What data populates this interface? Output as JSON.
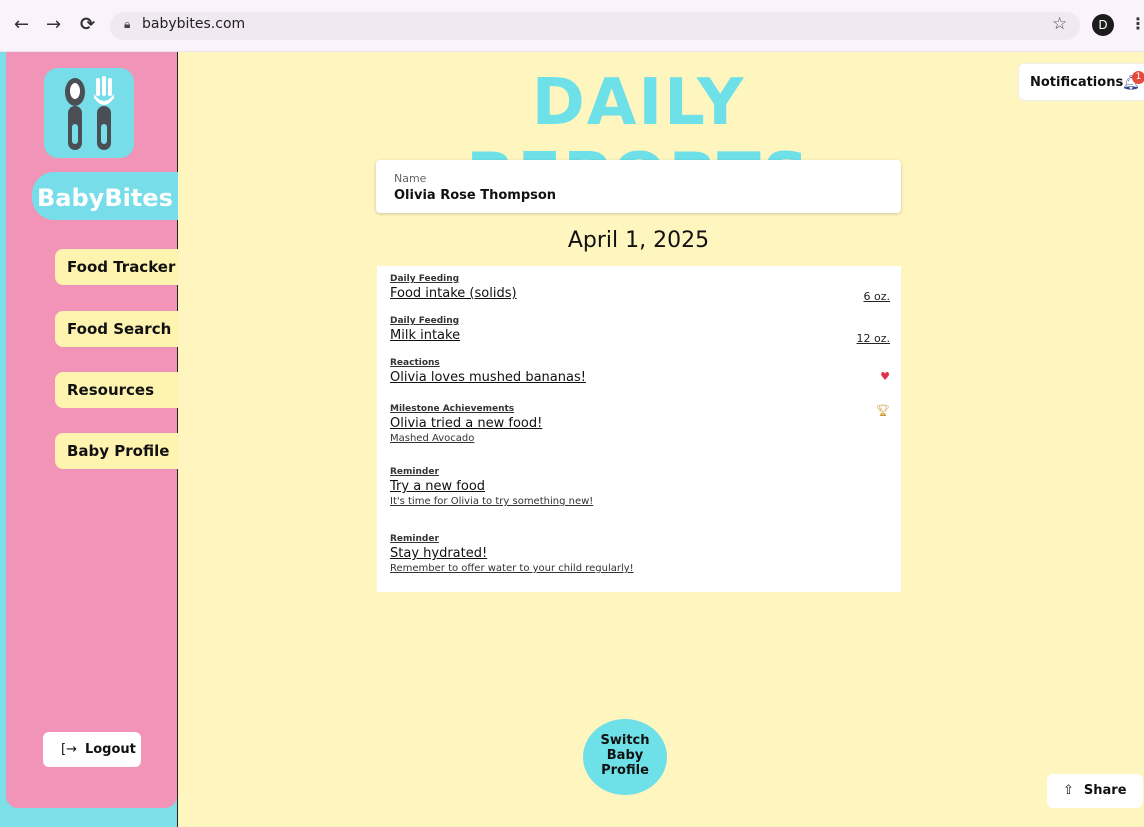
{
  "browser": {
    "url": "babybites.com",
    "back_icon": "←",
    "forward_icon": "→",
    "reload_icon": "C",
    "avatar_letter": "D"
  },
  "sidebar": {
    "brand": "BabyBites",
    "items": [
      {
        "label": "Food Tracker"
      },
      {
        "label": "Food Search"
      },
      {
        "label": "Resources"
      },
      {
        "label": "Baby Profile"
      }
    ],
    "logout_label": "Logout"
  },
  "header": {
    "title": "DAILY REPORTS",
    "notifications_label": "Notifications",
    "notifications_count": "1"
  },
  "name_field": {
    "label": "Name",
    "value": "Olivia Rose Thompson"
  },
  "report": {
    "date": "April 1, 2025",
    "entries": [
      {
        "category": "Daily Feeding",
        "title": "Food intake (solids)",
        "value": "6 oz."
      },
      {
        "category": "Daily Feeding",
        "title": "Milk intake",
        "value": "12 oz."
      },
      {
        "category": "Reactions",
        "title": "Olivia loves mushed bananas!",
        "icon": "heart-icon"
      },
      {
        "category": "Milestone Achievements",
        "title": "Olivia tried a new food!",
        "subtitle": "Mashed Avocado",
        "icon": "trophy-icon"
      },
      {
        "category": "Reminder",
        "title": "Try a new food",
        "subtitle": "It's time for Olivia to try something new!"
      },
      {
        "category": "Reminder",
        "title": "Stay hydrated!",
        "subtitle": "Remember to offer water to your child regularly!"
      }
    ]
  },
  "actions": {
    "switch_line1": "Switch",
    "switch_line2": "Baby",
    "switch_line3": "Profile",
    "share_label": "Share"
  },
  "colors": {
    "sidebar_pink": "#f293b8",
    "accent_cyan": "#6ee0e8",
    "background_yellow": "#fff5bf",
    "nav_item_yellow": "#fff3b0"
  }
}
